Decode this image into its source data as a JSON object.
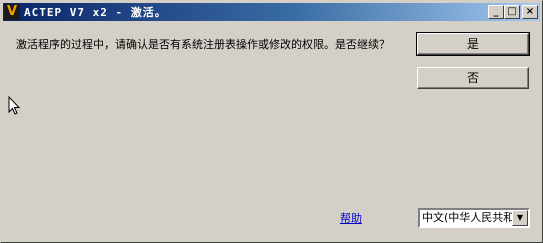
{
  "window": {
    "title": "ACTEP V7 x2 - 激活。",
    "app_icon": "V",
    "buttons": {
      "minimize": "_",
      "maximize": "□",
      "close": "×"
    }
  },
  "dialog": {
    "message": "激活程序的过程中，请确认是否有系统注册表操作或修改的权限。是否继续？",
    "yes_label": "是",
    "no_label": "否",
    "help_label": "帮助",
    "language_value": "中文(中华人民共和国)"
  },
  "colors": {
    "titlebar_start": "#0a246a",
    "titlebar_end": "#a6caf0",
    "face": "#d4d0c8",
    "link": "#0000cc"
  },
  "icons": [
    "app-icon",
    "minimize-icon",
    "maximize-icon",
    "close-icon",
    "dropdown-arrow-icon",
    "mouse-cursor-icon"
  ]
}
